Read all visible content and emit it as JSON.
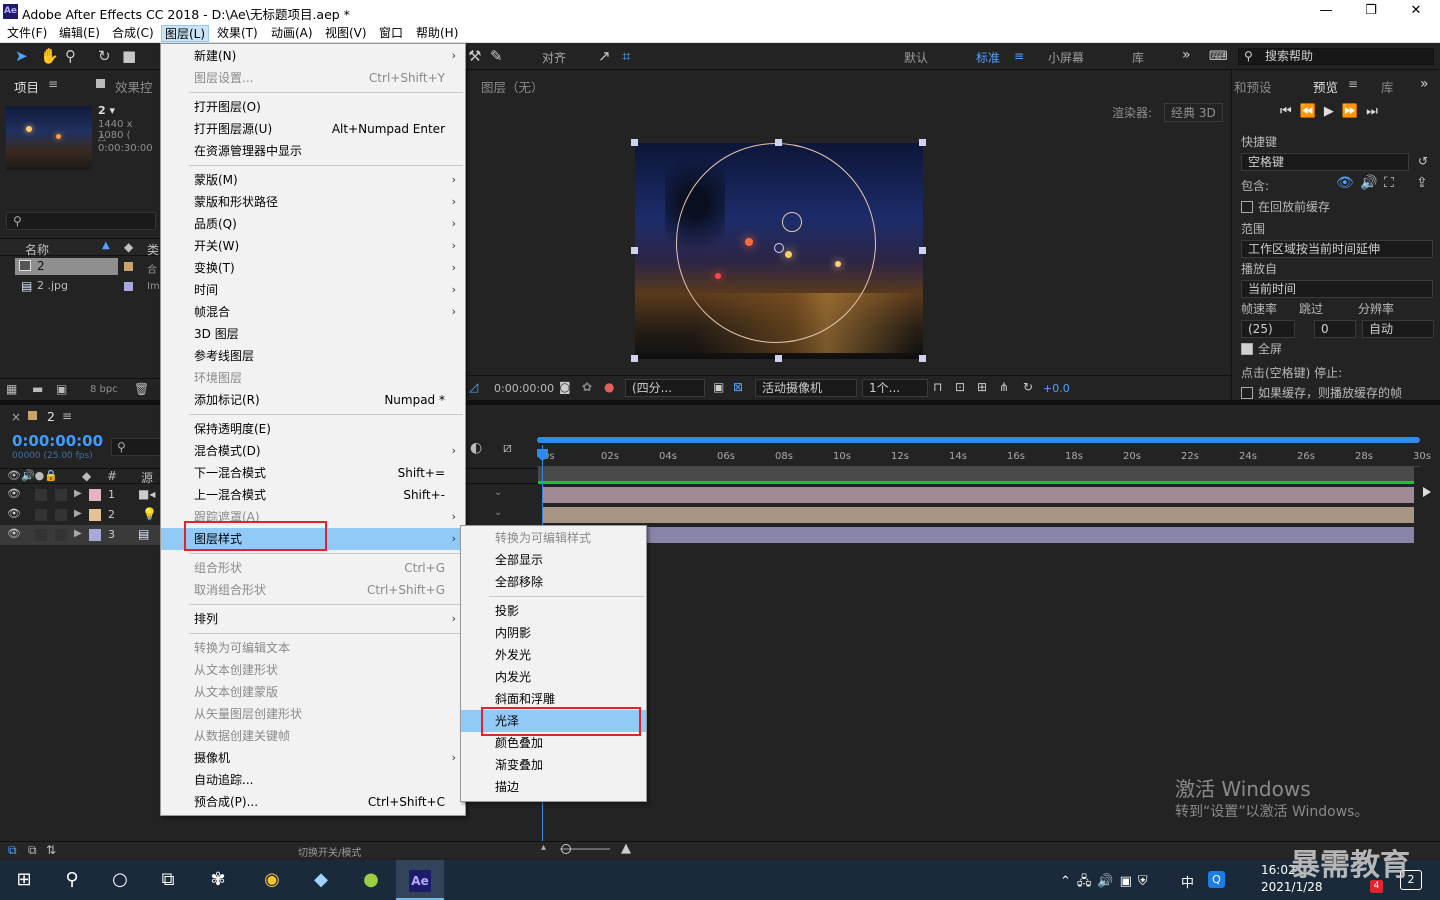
{
  "window": {
    "app_icon": "Ae",
    "title": "Adobe After Effects CC 2018 - D:\\Ae\\无标题项目.aep *",
    "minimize": "—",
    "maximize": "❐",
    "close": "✕"
  },
  "menubar": [
    "文件(F)",
    "编辑(E)",
    "合成(C)",
    "图层(L)",
    "效果(T)",
    "动画(A)",
    "视图(V)",
    "窗口",
    "帮助(H)"
  ],
  "toolbar": {
    "snap_label": "对齐",
    "workspaces": [
      "默认",
      "标准",
      "小屏幕",
      "库"
    ],
    "active_workspace": "标准",
    "more": "»",
    "search_placeholder": "搜索帮助"
  },
  "project_panel": {
    "tab_project": "项目",
    "tab_effects": "效果控",
    "selected_name": "2 ▾",
    "selected_info1": "1440 x 1080 (",
    "selected_info2": "△ 0:00:30:00",
    "col_name": "名称",
    "col_type": "类",
    "items": [
      {
        "name": "2",
        "type": "合"
      },
      {
        "name": "2 .jpg",
        "type": "Im"
      }
    ],
    "bpc": "8 bpc"
  },
  "viewer": {
    "header": "图层（无）",
    "renderer_label": "渲染器:",
    "renderer_value": "经典 3D",
    "timecode": "0:00:00:00",
    "quality": "(四分...",
    "camera": "活动摄像机",
    "views": "1个...",
    "exposure": "+0.0"
  },
  "preview_panel": {
    "tab_presets": "和预设",
    "tab_preview": "预览",
    "tab_library": "库",
    "shortcut_label": "快捷键",
    "shortcut_value": "空格键",
    "include_label": "包含:",
    "cache_before": "在回放前缓存",
    "range_label": "范围",
    "range_value": "工作区域按当前时间延伸",
    "play_from_label": "播放自",
    "play_from_value": "当前时间",
    "fps_label": "帧速率",
    "skip_label": "跳过",
    "res_label": "分辨率",
    "fps_value": "(25)",
    "skip_value": "0",
    "res_value": "自动",
    "fullscreen": "全屏",
    "stop_label": "点击(空格键) 停止:",
    "if_cached": "如果缓存，则播放缓存的帧"
  },
  "timeline": {
    "comp_tab": "2",
    "timecode": "0:00:00:00",
    "frames": "00000 (25.00 fps)",
    "col_num": "#",
    "col_source": "源",
    "ruler": [
      "0s",
      "02s",
      "04s",
      "06s",
      "08s",
      "10s",
      "12s",
      "14s",
      "16s",
      "18s",
      "20s",
      "22s",
      "24s",
      "26s",
      "28s",
      "30s"
    ],
    "layers": [
      {
        "num": "1",
        "color": "#e8b3c0"
      },
      {
        "num": "2",
        "color": "#e8c197"
      },
      {
        "num": "3",
        "color": "#a9a9d9"
      }
    ],
    "toggle_label": "切换开关/模式"
  },
  "layer_menu": [
    {
      "label": "新建(N)",
      "arrow": true
    },
    {
      "label": "图层设置...",
      "shortcut": "Ctrl+Shift+Y",
      "disabled": true
    },
    {
      "sep": true
    },
    {
      "label": "打开图层(O)"
    },
    {
      "label": "打开图层源(U)",
      "shortcut": "Alt+Numpad Enter"
    },
    {
      "label": "在资源管理器中显示"
    },
    {
      "sep": true
    },
    {
      "label": "蒙版(M)",
      "arrow": true
    },
    {
      "label": "蒙版和形状路径",
      "arrow": true
    },
    {
      "label": "品质(Q)",
      "arrow": true
    },
    {
      "label": "开关(W)",
      "arrow": true
    },
    {
      "label": "变换(T)",
      "arrow": true
    },
    {
      "label": "时间",
      "arrow": true
    },
    {
      "label": "帧混合",
      "arrow": true
    },
    {
      "label": "3D 图层"
    },
    {
      "label": "参考线图层"
    },
    {
      "label": "环境图层",
      "disabled": true
    },
    {
      "label": "添加标记(R)",
      "shortcut": "Numpad *"
    },
    {
      "sep": true
    },
    {
      "label": "保持透明度(E)"
    },
    {
      "label": "混合模式(D)",
      "arrow": true
    },
    {
      "label": "下一混合模式",
      "shortcut": "Shift+="
    },
    {
      "label": "上一混合模式",
      "shortcut": "Shift+-"
    },
    {
      "label": "跟踪遮罩(A)",
      "arrow": true,
      "disabled": true
    },
    {
      "label": "图层样式",
      "arrow": true,
      "highlight": true
    },
    {
      "sep": true
    },
    {
      "label": "组合形状",
      "shortcut": "Ctrl+G",
      "disabled": true
    },
    {
      "label": "取消组合形状",
      "shortcut": "Ctrl+Shift+G",
      "disabled": true
    },
    {
      "sep": true
    },
    {
      "label": "排列",
      "arrow": true
    },
    {
      "sep": true
    },
    {
      "label": "转换为可编辑文本",
      "disabled": true
    },
    {
      "label": "从文本创建形状",
      "disabled": true
    },
    {
      "label": "从文本创建蒙版",
      "disabled": true
    },
    {
      "label": "从矢量图层创建形状",
      "disabled": true
    },
    {
      "label": "从数据创建关键帧",
      "disabled": true
    },
    {
      "label": "摄像机",
      "arrow": true
    },
    {
      "label": "自动追踪..."
    },
    {
      "label": "预合成(P)...",
      "shortcut": "Ctrl+Shift+C"
    }
  ],
  "style_submenu": [
    {
      "label": "转换为可编辑样式",
      "disabled": true
    },
    {
      "label": "全部显示"
    },
    {
      "label": "全部移除"
    },
    {
      "sep": true
    },
    {
      "label": "投影"
    },
    {
      "label": "内阴影"
    },
    {
      "label": "外发光"
    },
    {
      "label": "内发光"
    },
    {
      "label": "斜面和浮雕"
    },
    {
      "label": "光泽",
      "highlight": true
    },
    {
      "label": "颜色叠加"
    },
    {
      "label": "渐变叠加"
    },
    {
      "label": "描边"
    }
  ],
  "watermark": {
    "line1": "激活 Windows",
    "line2": "转到“设置”以激活 Windows。"
  },
  "brand": "暴需教育",
  "taskbar": {
    "time": "16:02",
    "date": "2021/1/28",
    "ime": "中",
    "notif_count": "4",
    "notif2": "2"
  },
  "colors": {
    "accent": "#2d8ceb",
    "menu_highlight": "#91c9f7",
    "red_box": "#e0232d"
  }
}
